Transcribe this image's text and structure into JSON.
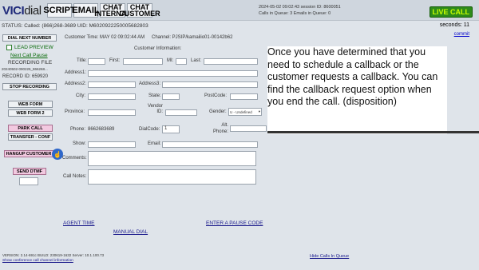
{
  "header": {
    "logo_main": "VICI",
    "logo_dial": "dial",
    "tabs": [
      "SCRIPT",
      "EMAIL",
      "CHAT INTERNAL",
      "CHAT CUSTOMER"
    ],
    "session_info": "2024-05-02 09:02:43   session ID: 8600051",
    "calls_in_queue": "Calls in Queue: 3    Emails in Queue: 0",
    "live_call": "LIVE CALL"
  },
  "status_line": "STATUS: Called: (866)268-3689 UID: M6020922250005682803",
  "seconds": "seconds: 11",
  "commit": "commit",
  "left_panel": {
    "dial_next": "DIAL NEXT NUMBER",
    "lead_preview": "LEAD PREVIEW",
    "next_call_pause": "Next Call Pause",
    "recording_file": "RECORDING FILE",
    "recording_name": "20240502-090225_866268...",
    "record_id": "RECORD ID: 659920",
    "stop_recording": "STOP RECORDING",
    "web_form": "WEB FORM",
    "web_form_2": "WEB FORM 2",
    "park_call": "PARK CALL",
    "transfer_conf": "TRANSFER - CONF",
    "hangup": "HANGUP CUSTOMER",
    "send_dtmf": "SEND DTMF"
  },
  "form": {
    "customer_time": "Customer Time: MAY 02 09:02:44 AM",
    "channel": "Channel: PJSIP/kamailio01-00142b62",
    "info_title": "Customer Information:",
    "title": "Title:",
    "first": "First:",
    "mi": "MI:",
    "last": "Last:",
    "address1": "Address1:",
    "address2": "Address2:",
    "address3": "Address3:",
    "city": "City:",
    "state": "State:",
    "postcode": "PostCode:",
    "province": "Province:",
    "vendor_id": "Vendor ID:",
    "gender": "Gender:",
    "gender_value": "U - Undefined",
    "phone_label": "Phone:",
    "phone_value": "8662683689",
    "dial_code": "DialCode:",
    "dial_code_value": "1",
    "alt_phone": "Alt. Phone:",
    "show": "Show:",
    "email": "Email:",
    "comments": "Comments:",
    "call_notes": "Call Notes:"
  },
  "bottom_links": {
    "agent_time": "AGENT TIME",
    "manual_dial": "MANUAL DIAL",
    "pause_code": "ENTER A PAUSE CODE",
    "hide_calls": "Hide Calls In Queue",
    "version": "VERSION: 2.14-691c   BUILD: 230619-1632   Server: 10.1.100.73",
    "conf_info": "Show conference call channel information"
  },
  "overlay_text": "Once you have determined that you need to schedule a callback or the customer requests a callback. You can find the callback request option when you end the call. (disposition)"
}
